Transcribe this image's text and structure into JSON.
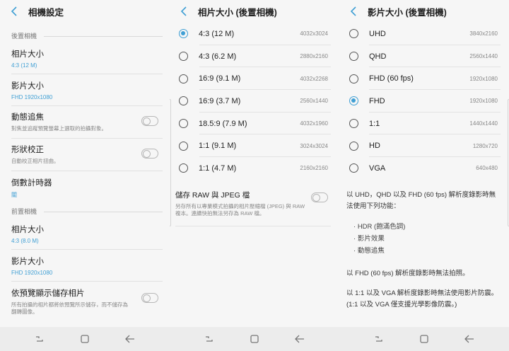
{
  "left": {
    "title": "相機設定",
    "rear_header": "後置相機",
    "rear_items": [
      {
        "title": "相片大小",
        "value": "4:3 (12 M)"
      },
      {
        "title": "影片大小",
        "value": "FHD 1920x1080"
      }
    ],
    "tracking": {
      "title": "動態追焦",
      "desc": "對焦並追蹤預覽螢幕上選取的拍攝對象。"
    },
    "shape": {
      "title": "形狀校正",
      "desc": "自動校正相片扭曲。"
    },
    "timer": {
      "title": "倒數計時器",
      "value": "關"
    },
    "front_header": "前置相機",
    "front_items": [
      {
        "title": "相片大小",
        "value": "4:3 (8.0 M)"
      },
      {
        "title": "影片大小",
        "value": "FHD 1920x1080"
      }
    ],
    "preview_save": {
      "title": "依預覽顯示儲存相片",
      "desc": "所有拍攝的相片都將依預覽所示儲存，而不儲存為翻轉圖像。"
    }
  },
  "middle": {
    "title": "相片大小 (後置相機)",
    "options": [
      {
        "label": "4:3 (12 M)",
        "res": "4032x3024",
        "selected": true
      },
      {
        "label": "4:3 (6.2 M)",
        "res": "2880x2160",
        "selected": false
      },
      {
        "label": "16:9 (9.1 M)",
        "res": "4032x2268",
        "selected": false
      },
      {
        "label": "16:9 (3.7 M)",
        "res": "2560x1440",
        "selected": false
      },
      {
        "label": "18.5:9 (7.9 M)",
        "res": "4032x1960",
        "selected": false
      },
      {
        "label": "1:1 (9.1 M)",
        "res": "3024x3024",
        "selected": false
      },
      {
        "label": "1:1 (4.7 M)",
        "res": "2160x2160",
        "selected": false
      }
    ],
    "raw": {
      "title": "儲存 RAW 與 JPEG 檔",
      "desc": "另存所有以專業模式拍攝的相片壓縮檔 (JPEG) 與 RAW 複本。連續快拍無法另存為 RAW 檔。"
    }
  },
  "right": {
    "title": "影片大小 (後置相機)",
    "options": [
      {
        "label": "UHD",
        "res": "3840x2160",
        "selected": false
      },
      {
        "label": "QHD",
        "res": "2560x1440",
        "selected": false
      },
      {
        "label": "FHD (60 fps)",
        "res": "1920x1080",
        "selected": false
      },
      {
        "label": "FHD",
        "res": "1920x1080",
        "selected": true
      },
      {
        "label": "1:1",
        "res": "1440x1440",
        "selected": false
      },
      {
        "label": "HD",
        "res": "1280x720",
        "selected": false
      },
      {
        "label": "VGA",
        "res": "640x480",
        "selected": false
      }
    ],
    "info1": "以 UHD，QHD 以及 FHD (60 fps) 解析度錄影時無法使用下列功能：",
    "bullets": [
      "HDR (飽滿色調)",
      "影片效果",
      "動態追焦"
    ],
    "info2": "以 FHD (60 fps) 解析度錄影時無法拍照。",
    "info3": "以 1:1 以及 VGA 解析度錄影時無法使用影片防震。(1:1 以及 VGA 僅支援光學影像防震。)"
  },
  "colors": {
    "accent": "#3f9fd4",
    "background": "#f6f6f6"
  },
  "icons": {
    "back": "back-arrow-icon",
    "recents": "recent-apps-icon",
    "home": "home-icon",
    "nav_back": "nav-back-icon"
  }
}
